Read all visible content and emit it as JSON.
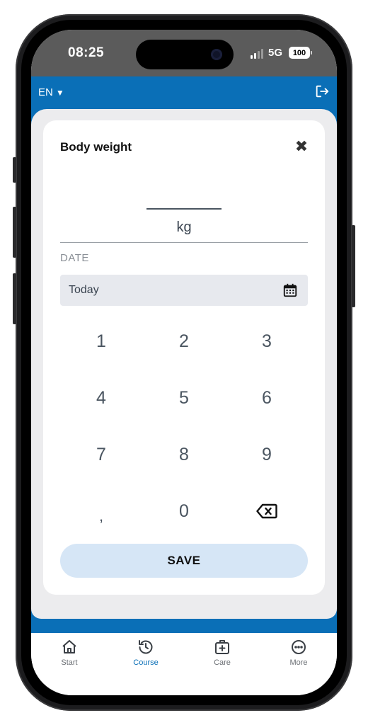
{
  "status_bar": {
    "time": "08:25",
    "network": "5G",
    "battery": "100"
  },
  "header": {
    "language": "EN",
    "language_caret": "▼"
  },
  "modal": {
    "title": "Body weight",
    "close_glyph": "✖",
    "unit": "kg",
    "date_label": "DATE",
    "date_value": "Today",
    "save_label": "SAVE"
  },
  "keypad": {
    "keys": [
      "1",
      "2",
      "3",
      "4",
      "5",
      "6",
      "7",
      "8",
      "9",
      ",",
      "0"
    ]
  },
  "tabbar": {
    "tabs": [
      {
        "label": "Start",
        "icon": "home-icon"
      },
      {
        "label": "Course",
        "icon": "history-icon",
        "active": true
      },
      {
        "label": "Care",
        "icon": "medical-kit-icon"
      },
      {
        "label": "More",
        "icon": "more-icon"
      }
    ]
  },
  "colors": {
    "primary": "#0a6fb7",
    "save_button": "#d6e6f6",
    "active_tab": "#0a6fb7"
  }
}
